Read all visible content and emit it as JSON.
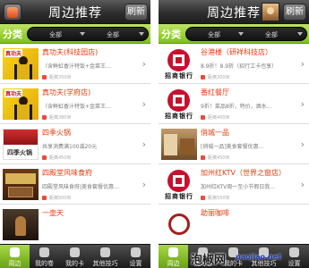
{
  "left": {
    "title": "周边推荐",
    "refresh_label": "刷新",
    "filter_label": "分类",
    "filter_options": [
      "全部",
      "全部"
    ],
    "items": [
      {
        "name": "真功夫(科技园店)",
        "desc": "（含鲜虹香汁特饭+金菜王…",
        "dist": "距离350米",
        "thumb": "kungfu",
        "thumb_text": "真功夫"
      },
      {
        "name": "真功夫(学府店)",
        "desc": "（含鲜虹香汁特饭+金菜王…",
        "dist": "距离380米",
        "thumb": "kungfu",
        "thumb_text": "真功夫"
      },
      {
        "name": "四季火锅",
        "desc": "共享消费满100减20元",
        "dist": "距离450米",
        "thumb": "hotpot",
        "thumb_text": "四季火锅"
      },
      {
        "name": "四殿堂风味食府",
        "desc": "四殿堂风味食府|美食套餐优惠…",
        "dist": "距离500米",
        "thumb": "hunan",
        "thumb_text": ""
      },
      {
        "name": "一壶天",
        "desc": "",
        "dist": "",
        "thumb": "dark",
        "thumb_text": ""
      }
    ],
    "tabs": [
      "周边",
      "我的卷",
      "我的卡",
      "其他技巧",
      "设置"
    ]
  },
  "right": {
    "title": "周边推荐",
    "refresh_label": "刷新",
    "filter_label": "分类",
    "filter_options": [
      "全部",
      "全部"
    ],
    "items": [
      {
        "name": "谷港楼（研祥科技店）",
        "desc": "8.9折！8.9折（招行工卡也享）",
        "dist": "距离300米",
        "thumb": "bank",
        "thumb_text": "招商银行"
      },
      {
        "name": "番红餐厅",
        "desc": "9折！菜品8折，特价，酒水…",
        "dist": "距离400米",
        "thumb": "bank",
        "thumb_text": "招商银行"
      },
      {
        "name": "俏城一品",
        "desc": "[俏城一品]美食套餐优惠…",
        "dist": "距离450米",
        "thumb": "cafe",
        "thumb_text": ""
      },
      {
        "name": "加州红KTV（世界之窗店）",
        "desc": "加州红KTV周一至小节假日我…",
        "dist": "距离550米",
        "thumb": "bank",
        "thumb_text": "招商银行"
      },
      {
        "name": "助丽咖啡",
        "desc": "",
        "dist": "",
        "thumb": "logo2",
        "thumb_text": ""
      }
    ],
    "tabs": [
      "周边",
      "我的卷",
      "我的卡",
      "其他技巧",
      "设置"
    ]
  },
  "watermark": {
    "main": "泡椒网",
    "sub": "paojiao.net"
  },
  "colors": {
    "accent_green": "#8cc925",
    "title_dark": "#2e2e2e",
    "item_name": "#e53a0b"
  },
  "icons": {
    "arrow": "chevron-right-icon"
  }
}
